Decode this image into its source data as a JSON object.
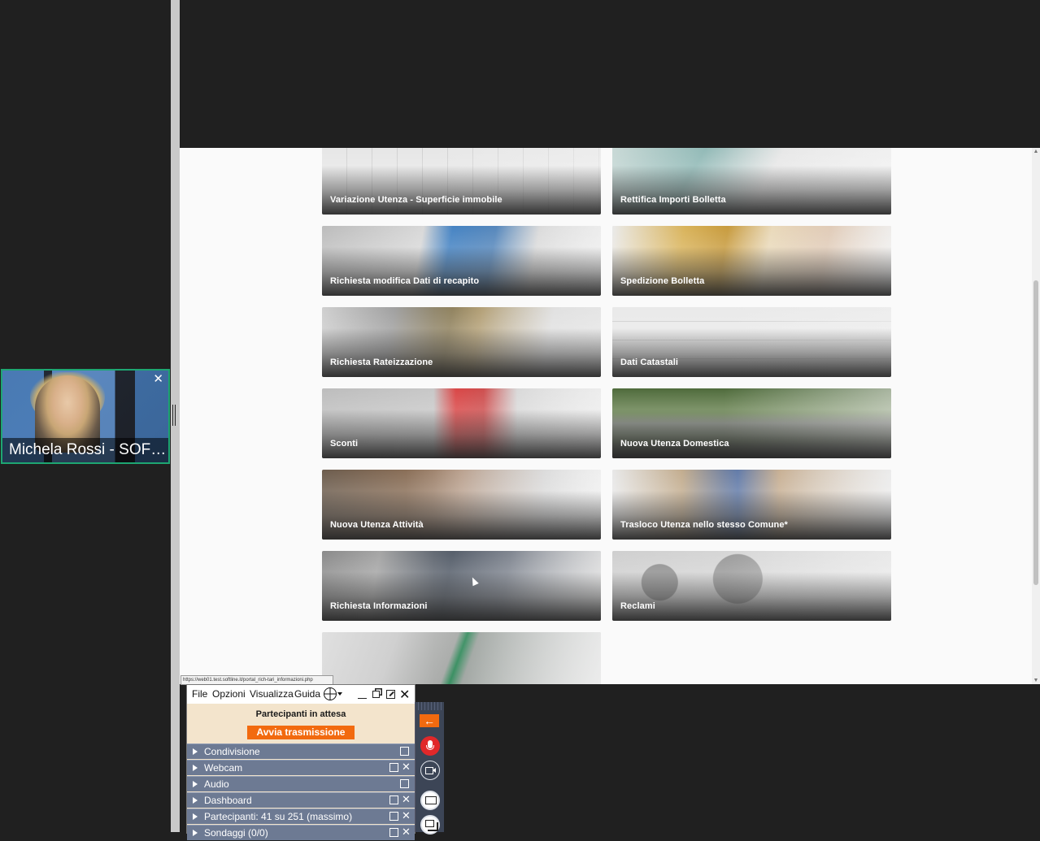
{
  "participant": {
    "name": "Michela Rossi - SOFTLINE",
    "accent_color": "#1ea672"
  },
  "webpage": {
    "cards": [
      {
        "label": "Variazione Utenza - Superficie immobile"
      },
      {
        "label": "Rettifica Importi Bolletta"
      },
      {
        "label": "Richiesta modifica Dati di recapito"
      },
      {
        "label": "Spedizione Bolletta"
      },
      {
        "label": "Richiesta Rateizzazione"
      },
      {
        "label": "Dati Catastali"
      },
      {
        "label": "Sconti"
      },
      {
        "label": "Nuova Utenza Domestica"
      },
      {
        "label": "Nuova Utenza Attività"
      },
      {
        "label": "Trasloco Utenza nello stesso Comune*"
      },
      {
        "label": "Richiesta Informazioni"
      },
      {
        "label": "Reclami"
      },
      {
        "label": ""
      }
    ],
    "status_url": "https://web01.test.softline.it/portal_rich-tari_informazioni.php"
  },
  "panel": {
    "menu": {
      "file": "File",
      "options": "Opzioni",
      "view": "Visualizza",
      "help": "Guida"
    },
    "waiting_title": "Partecipanti in attesa",
    "broadcast_button": "Avvia trasmissione",
    "sections": [
      {
        "label": "Condivisione"
      },
      {
        "label": "Webcam"
      },
      {
        "label": "Audio"
      },
      {
        "label": "Dashboard"
      },
      {
        "label": "Partecipanti:  41 su 251 (massimo)"
      },
      {
        "label": "Sondaggi (0/0)"
      }
    ],
    "accent_color": "#f26a0f",
    "section_color": "#6d7a93"
  },
  "toolbar": {
    "back_arrow": "←",
    "icons": [
      "arrow-left-icon",
      "microphone-icon",
      "webcam-icon",
      "screen-share-icon",
      "window-share-icon"
    ]
  }
}
